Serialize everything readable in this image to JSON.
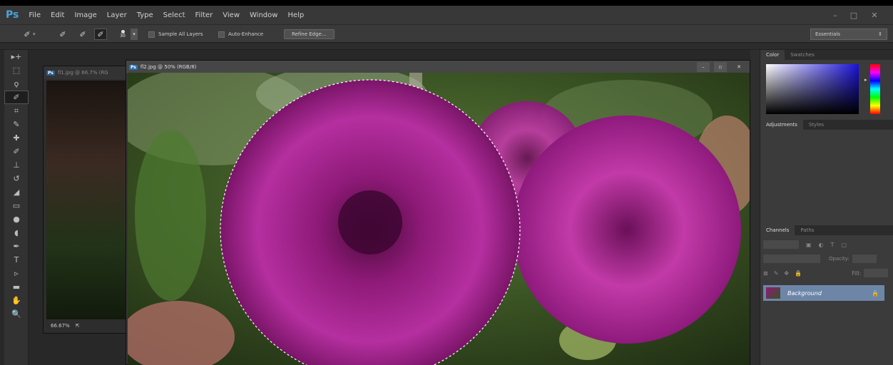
{
  "app": {
    "logo": "Ps"
  },
  "menu": [
    "File",
    "Edit",
    "Image",
    "Layer",
    "Type",
    "Select",
    "Filter",
    "View",
    "Window",
    "Help"
  ],
  "window_controls": {
    "minimize": "–",
    "restore": "□",
    "close": "✕"
  },
  "options_bar": {
    "brush_size": "30",
    "sample_all_layers": "Sample All Layers",
    "auto_enhance": "Auto-Enhance",
    "refine_edge": "Refine Edge...",
    "workspace": "Essentials"
  },
  "tools": [
    "move",
    "marquee",
    "lasso",
    "quick-selection",
    "crop",
    "eyedropper",
    "healing",
    "brush",
    "stamp",
    "history-brush",
    "eraser",
    "gradient",
    "blur",
    "dodge",
    "pen",
    "type",
    "path-selection",
    "shape",
    "hand",
    "zoom"
  ],
  "documents": {
    "back": {
      "title": "fl1.jpg @ 66.7% (RG",
      "zoom": "66.67%"
    },
    "front": {
      "title": "fl2.jpg @ 50% (RGB/8)"
    }
  },
  "panels": {
    "color_tabs": [
      "Color",
      "Swatches"
    ],
    "adjust_tabs": [
      "Adjustments",
      "Styles"
    ],
    "layers_tabs": [
      "Channels",
      "Paths"
    ],
    "opacity_label": "Opacity:",
    "fill_label": "Fill:",
    "layer_name": "Background"
  },
  "colors": {
    "accent": "#2a6fb0",
    "selection_highlight": "#6d86a8"
  }
}
